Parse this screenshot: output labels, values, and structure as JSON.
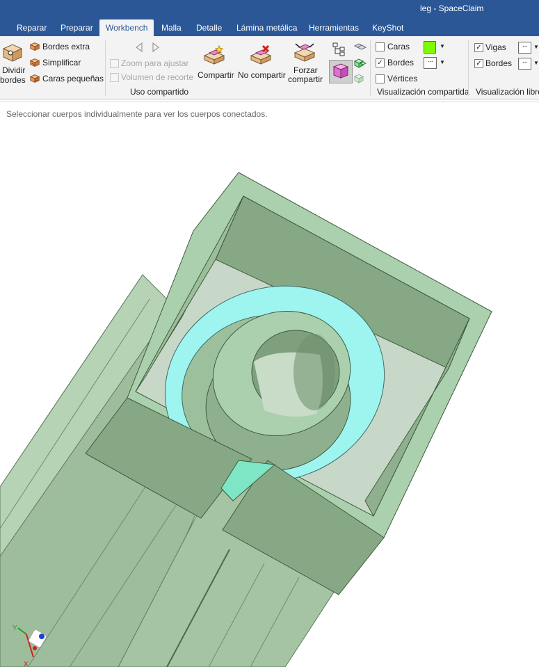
{
  "window": {
    "title": "leg - SpaceClaim"
  },
  "tabs": [
    {
      "label": "Reparar"
    },
    {
      "label": "Preparar"
    },
    {
      "label": "Workbench",
      "active": true
    },
    {
      "label": "Malla"
    },
    {
      "label": "Detalle"
    },
    {
      "label": "Lámina metálica"
    },
    {
      "label": "Herramientas"
    },
    {
      "label": "KeyShot"
    }
  ],
  "ribbon": {
    "split_edges": {
      "line1": "Dividir",
      "line2": "bordes"
    },
    "extra_edges": "Bordes extra",
    "simplify": "Simplificar",
    "small_faces": "Caras pequeñas",
    "zoom_to_fit": "Zoom para ajustar",
    "clip_volume": "Volumen de recorte",
    "share": "Compartir",
    "unshare": "No compartir",
    "force_share": {
      "line1": "Forzar",
      "line2": "compartir"
    },
    "group_shared_use": "Uso compartido",
    "faces": "Caras",
    "edges": "Bordes",
    "vertices": "Vértices",
    "group_shared_display": "Visualización compartida",
    "beams": "Vigas",
    "edges2": "Bordes",
    "group_free_display": "Visualización libre",
    "faces_color": "#7cfc00"
  },
  "status": {
    "hint": "Seleccionar cuerpos individualmente para ver los cuerpos conectados."
  },
  "axis_triad": {
    "y": "Y",
    "x": "X"
  },
  "colors": {
    "titlebar": "#2b5797",
    "ribbon": "#f3f3f3",
    "part_green": "#a8ccac",
    "part_dark": "#86a885",
    "ring_cyan": "#9ef5ef"
  }
}
